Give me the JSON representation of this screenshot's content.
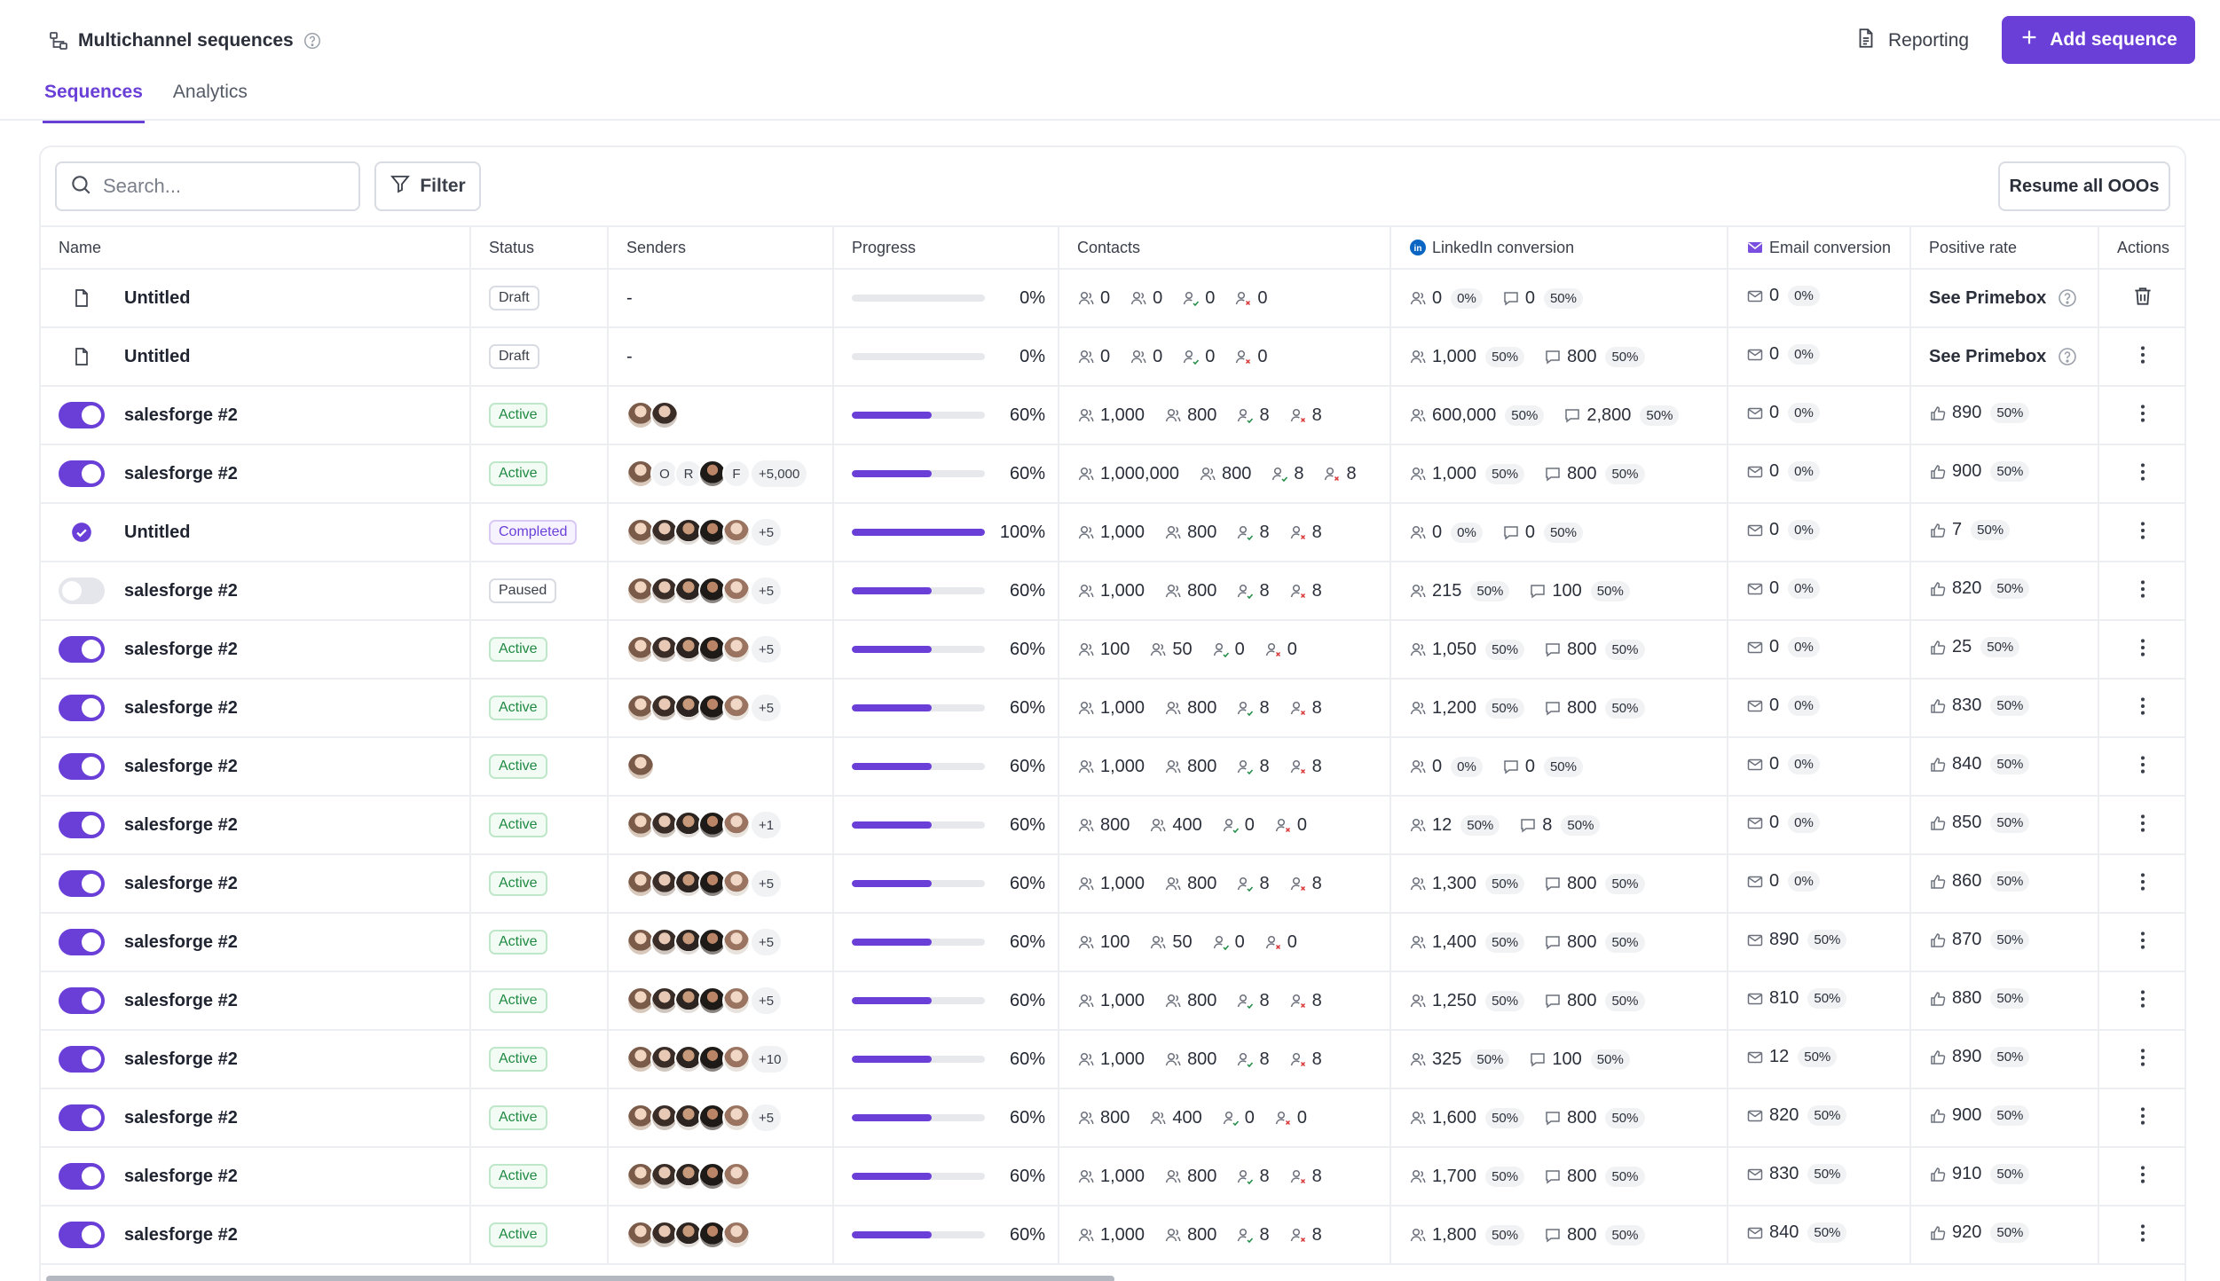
{
  "header": {
    "title": "Multichannel sequences",
    "reporting_label": "Reporting",
    "add_sequence_label": "Add sequence",
    "tabs": [
      {
        "label": "Sequences",
        "active": true
      },
      {
        "label": "Analytics",
        "active": false
      }
    ]
  },
  "toolbar": {
    "search_placeholder": "Search...",
    "filter_label": "Filter",
    "resume_label": "Resume all OOOs"
  },
  "colors": {
    "accent": "#6a3fd8",
    "active_green": "#1f8a43",
    "linkedin_blue": "#0a66c2"
  },
  "table": {
    "columns": [
      "Name",
      "Status",
      "Senders",
      "Progress",
      "Contacts",
      "LinkedIn conversion",
      "Email conversion",
      "Positive rate",
      "Actions"
    ],
    "rows": [
      {
        "lead": "doc",
        "name": "Untitled",
        "status": "Draft",
        "senders_text": "-",
        "senders": [],
        "more": "",
        "progress": 0,
        "progress_label": "0%",
        "contacts": [
          "0",
          "0",
          "0",
          "0"
        ],
        "li_accepted": "0",
        "li_accepted_pct": "0%",
        "li_replied": "0",
        "li_replied_pct": "50%",
        "email": "0",
        "email_pct": "0%",
        "positive": "See Primebox",
        "positive_pct": "",
        "action": "trash"
      },
      {
        "lead": "doc",
        "name": "Untitled",
        "status": "Draft",
        "senders_text": "-",
        "senders": [],
        "more": "",
        "progress": 0,
        "progress_label": "0%",
        "contacts": [
          "0",
          "0",
          "0",
          "0"
        ],
        "li_accepted": "1,000",
        "li_accepted_pct": "50%",
        "li_replied": "800",
        "li_replied_pct": "50%",
        "email": "0",
        "email_pct": "0%",
        "positive": "See Primebox",
        "positive_pct": "",
        "action": "more"
      },
      {
        "lead": "on",
        "name": "salesforge #2",
        "status": "Active",
        "senders_text": "",
        "senders": [
          "p1",
          "p2"
        ],
        "more": "",
        "progress": 60,
        "progress_label": "60%",
        "contacts": [
          "1,000",
          "800",
          "8",
          "8"
        ],
        "li_accepted": "600,000",
        "li_accepted_pct": "50%",
        "li_replied": "2,800",
        "li_replied_pct": "50%",
        "email": "0",
        "email_pct": "0%",
        "positive": "890",
        "positive_pct": "50%",
        "action": "more"
      },
      {
        "lead": "on",
        "name": "salesforge #2",
        "status": "Active",
        "senders_text": "",
        "senders": [
          "p1",
          "O",
          "R",
          "p4",
          "F"
        ],
        "more": "+5,000",
        "progress": 60,
        "progress_label": "60%",
        "contacts": [
          "1,000,000",
          "800",
          "8",
          "8"
        ],
        "li_accepted": "1,000",
        "li_accepted_pct": "50%",
        "li_replied": "800",
        "li_replied_pct": "50%",
        "email": "0",
        "email_pct": "0%",
        "positive": "900",
        "positive_pct": "50%",
        "action": "more"
      },
      {
        "lead": "check",
        "name": "Untitled",
        "status": "Completed",
        "senders_text": "",
        "senders": [
          "p1",
          "p2",
          "p3",
          "p4",
          "p5"
        ],
        "more": "+5",
        "progress": 100,
        "progress_label": "100%",
        "contacts": [
          "1,000",
          "800",
          "8",
          "8"
        ],
        "li_accepted": "0",
        "li_accepted_pct": "0%",
        "li_replied": "0",
        "li_replied_pct": "50%",
        "email": "0",
        "email_pct": "0%",
        "positive": "7",
        "positive_pct": "50%",
        "action": "more"
      },
      {
        "lead": "off",
        "name": "salesforge #2",
        "status": "Paused",
        "senders_text": "",
        "senders": [
          "p1",
          "p2",
          "p3",
          "p4",
          "p5"
        ],
        "more": "+5",
        "progress": 60,
        "progress_label": "60%",
        "contacts": [
          "1,000",
          "800",
          "8",
          "8"
        ],
        "li_accepted": "215",
        "li_accepted_pct": "50%",
        "li_replied": "100",
        "li_replied_pct": "50%",
        "email": "0",
        "email_pct": "0%",
        "positive": "820",
        "positive_pct": "50%",
        "action": "more"
      },
      {
        "lead": "on",
        "name": "salesforge #2",
        "status": "Active",
        "senders_text": "",
        "senders": [
          "p1",
          "p2",
          "p3",
          "p4",
          "p5"
        ],
        "more": "+5",
        "progress": 60,
        "progress_label": "60%",
        "contacts": [
          "100",
          "50",
          "0",
          "0"
        ],
        "li_accepted": "1,050",
        "li_accepted_pct": "50%",
        "li_replied": "800",
        "li_replied_pct": "50%",
        "email": "0",
        "email_pct": "0%",
        "positive": "25",
        "positive_pct": "50%",
        "action": "more"
      },
      {
        "lead": "on",
        "name": "salesforge #2",
        "status": "Active",
        "senders_text": "",
        "senders": [
          "p1",
          "p2",
          "p3",
          "p4",
          "p5"
        ],
        "more": "+5",
        "progress": 60,
        "progress_label": "60%",
        "contacts": [
          "1,000",
          "800",
          "8",
          "8"
        ],
        "li_accepted": "1,200",
        "li_accepted_pct": "50%",
        "li_replied": "800",
        "li_replied_pct": "50%",
        "email": "0",
        "email_pct": "0%",
        "positive": "830",
        "positive_pct": "50%",
        "action": "more"
      },
      {
        "lead": "on",
        "name": "salesforge #2",
        "status": "Active",
        "senders_text": "",
        "senders": [
          "p1"
        ],
        "more": "",
        "progress": 60,
        "progress_label": "60%",
        "contacts": [
          "1,000",
          "800",
          "8",
          "8"
        ],
        "li_accepted": "0",
        "li_accepted_pct": "0%",
        "li_replied": "0",
        "li_replied_pct": "50%",
        "email": "0",
        "email_pct": "0%",
        "positive": "840",
        "positive_pct": "50%",
        "action": "more"
      },
      {
        "lead": "on",
        "name": "salesforge #2",
        "status": "Active",
        "senders_text": "",
        "senders": [
          "p1",
          "p2",
          "p3",
          "p4",
          "p5"
        ],
        "more": "+1",
        "progress": 60,
        "progress_label": "60%",
        "contacts": [
          "800",
          "400",
          "0",
          "0"
        ],
        "li_accepted": "12",
        "li_accepted_pct": "50%",
        "li_replied": "8",
        "li_replied_pct": "50%",
        "email": "0",
        "email_pct": "0%",
        "positive": "850",
        "positive_pct": "50%",
        "action": "more"
      },
      {
        "lead": "on",
        "name": "salesforge #2",
        "status": "Active",
        "senders_text": "",
        "senders": [
          "p1",
          "p2",
          "p3",
          "p4",
          "p5"
        ],
        "more": "+5",
        "progress": 60,
        "progress_label": "60%",
        "contacts": [
          "1,000",
          "800",
          "8",
          "8"
        ],
        "li_accepted": "1,300",
        "li_accepted_pct": "50%",
        "li_replied": "800",
        "li_replied_pct": "50%",
        "email": "0",
        "email_pct": "0%",
        "positive": "860",
        "positive_pct": "50%",
        "action": "more"
      },
      {
        "lead": "on",
        "name": "salesforge #2",
        "status": "Active",
        "senders_text": "",
        "senders": [
          "p1",
          "p2",
          "p3",
          "p4",
          "p5"
        ],
        "more": "+5",
        "progress": 60,
        "progress_label": "60%",
        "contacts": [
          "100",
          "50",
          "0",
          "0"
        ],
        "li_accepted": "1,400",
        "li_accepted_pct": "50%",
        "li_replied": "800",
        "li_replied_pct": "50%",
        "email": "890",
        "email_pct": "50%",
        "positive": "870",
        "positive_pct": "50%",
        "action": "more"
      },
      {
        "lead": "on",
        "name": "salesforge #2",
        "status": "Active",
        "senders_text": "",
        "senders": [
          "p1",
          "p2",
          "p3",
          "p4",
          "p5"
        ],
        "more": "+5",
        "progress": 60,
        "progress_label": "60%",
        "contacts": [
          "1,000",
          "800",
          "8",
          "8"
        ],
        "li_accepted": "1,250",
        "li_accepted_pct": "50%",
        "li_replied": "800",
        "li_replied_pct": "50%",
        "email": "810",
        "email_pct": "50%",
        "positive": "880",
        "positive_pct": "50%",
        "action": "more"
      },
      {
        "lead": "on",
        "name": "salesforge #2",
        "status": "Active",
        "senders_text": "",
        "senders": [
          "p1",
          "p2",
          "p3",
          "p4",
          "p5"
        ],
        "more": "+10",
        "progress": 60,
        "progress_label": "60%",
        "contacts": [
          "1,000",
          "800",
          "8",
          "8"
        ],
        "li_accepted": "325",
        "li_accepted_pct": "50%",
        "li_replied": "100",
        "li_replied_pct": "50%",
        "email": "12",
        "email_pct": "50%",
        "positive": "890",
        "positive_pct": "50%",
        "action": "more"
      },
      {
        "lead": "on",
        "name": "salesforge #2",
        "status": "Active",
        "senders_text": "",
        "senders": [
          "p1",
          "p2",
          "p3",
          "p4",
          "p5"
        ],
        "more": "+5",
        "progress": 60,
        "progress_label": "60%",
        "contacts": [
          "800",
          "400",
          "0",
          "0"
        ],
        "li_accepted": "1,600",
        "li_accepted_pct": "50%",
        "li_replied": "800",
        "li_replied_pct": "50%",
        "email": "820",
        "email_pct": "50%",
        "positive": "900",
        "positive_pct": "50%",
        "action": "more"
      },
      {
        "lead": "on",
        "name": "salesforge #2",
        "status": "Active",
        "senders_text": "",
        "senders": [
          "p1",
          "p2",
          "p3",
          "p4",
          "p5"
        ],
        "more": "",
        "progress": 60,
        "progress_label": "60%",
        "contacts": [
          "1,000",
          "800",
          "8",
          "8"
        ],
        "li_accepted": "1,700",
        "li_accepted_pct": "50%",
        "li_replied": "800",
        "li_replied_pct": "50%",
        "email": "830",
        "email_pct": "50%",
        "positive": "910",
        "positive_pct": "50%",
        "action": "more"
      },
      {
        "lead": "on",
        "name": "salesforge #2",
        "status": "Active",
        "senders_text": "",
        "senders": [
          "p1",
          "p2",
          "p3",
          "p4",
          "p5"
        ],
        "more": "",
        "progress": 60,
        "progress_label": "60%",
        "contacts": [
          "1,000",
          "800",
          "8",
          "8"
        ],
        "li_accepted": "1,800",
        "li_accepted_pct": "50%",
        "li_replied": "800",
        "li_replied_pct": "50%",
        "email": "840",
        "email_pct": "50%",
        "positive": "920",
        "positive_pct": "50%",
        "action": "more"
      }
    ]
  }
}
